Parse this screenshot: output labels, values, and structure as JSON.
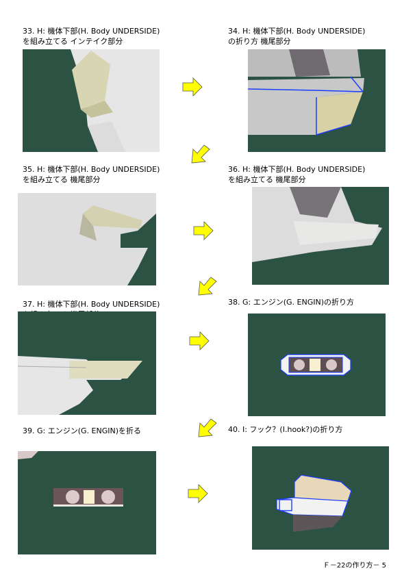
{
  "steps": [
    {
      "line1": "33. H: 機体下部(H. Body UNDERSIDE)",
      "line2": "を組み立てる インテイク部分"
    },
    {
      "line1": "34. H: 機体下部(H. Body UNDERSIDE)",
      "line2": "の折り方 機尾部分"
    },
    {
      "line1": "35. H: 機体下部(H. Body UNDERSIDE)",
      "line2": "を組み立てる 機尾部分"
    },
    {
      "line1": "36. H: 機体下部(H. Body UNDERSIDE)",
      "line2": "を組み立てる 機尾部分"
    },
    {
      "line1": "37. H: 機体下部(H. Body UNDERSIDE)",
      "line2": "を組み立てる 機尾部分"
    },
    {
      "line1": "38. G: エンジン(G. ENGIN)の折り方",
      "line2": ""
    },
    {
      "line1": "39. G: エンジン(G. ENGIN)を折る",
      "line2": ""
    },
    {
      "line1": "40. I: フック？(I.hook?)の折り方",
      "line2": ""
    }
  ],
  "footer": "Ｆ－22の作り方－ 5",
  "colors": {
    "arrow_fill": "#ffff00",
    "mat_green": "#2f5546",
    "blue_outline": "#1a3cff"
  }
}
